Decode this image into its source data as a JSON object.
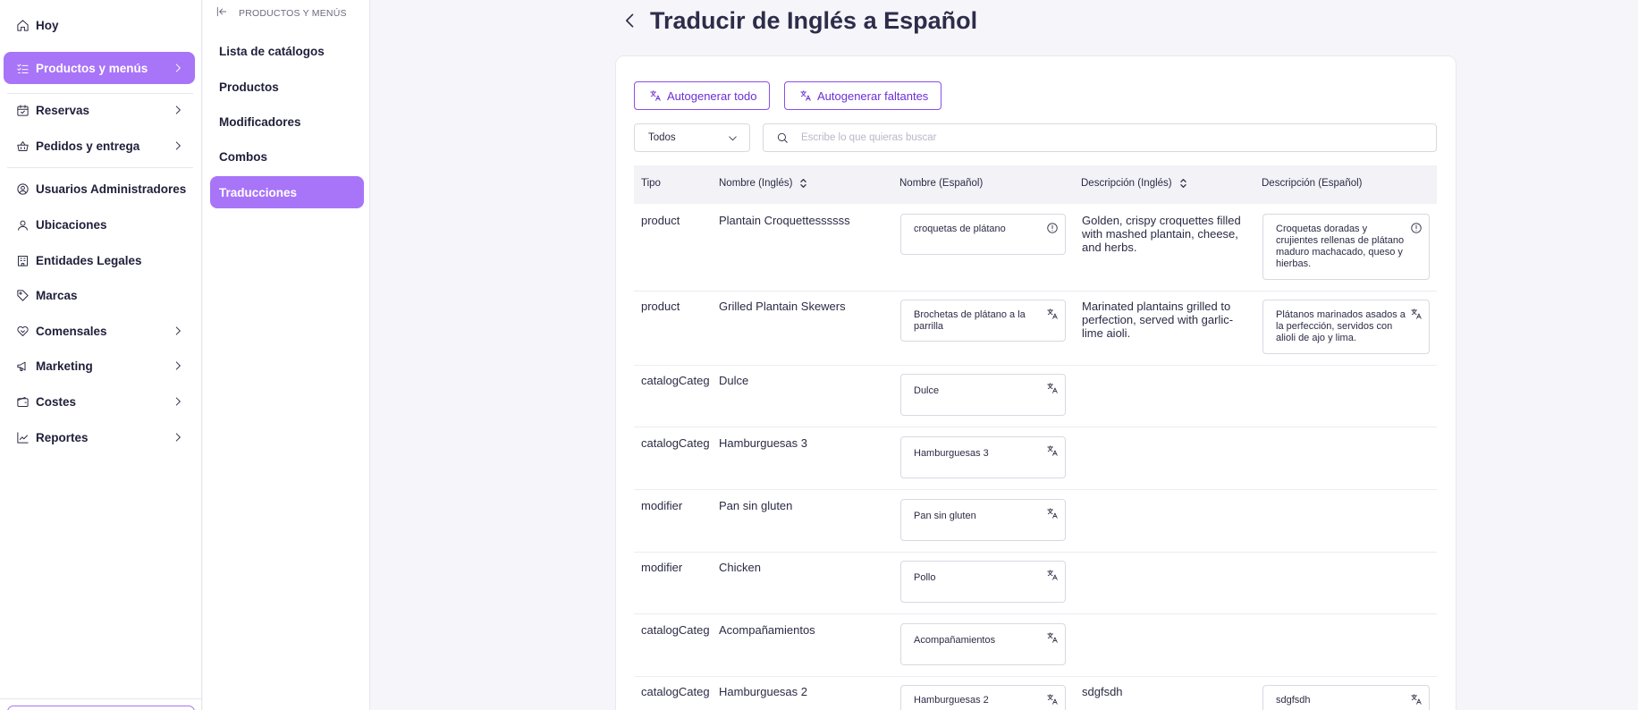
{
  "sidebar": {
    "items": [
      {
        "label": "Hoy"
      },
      {
        "label": "Productos y menús"
      },
      {
        "label": "Reservas"
      },
      {
        "label": "Pedidos y entrega"
      },
      {
        "label": "Usuarios Administradores"
      },
      {
        "label": "Ubicaciones"
      },
      {
        "label": "Entidades Legales"
      },
      {
        "label": "Marcas"
      },
      {
        "label": "Comensales"
      },
      {
        "label": "Marketing"
      },
      {
        "label": "Costes"
      },
      {
        "label": "Reportes"
      }
    ]
  },
  "subpanel": {
    "header": "PRODUCTOS Y MENÚS",
    "items": [
      {
        "label": "Lista de catálogos"
      },
      {
        "label": "Productos"
      },
      {
        "label": "Modificadores"
      },
      {
        "label": "Combos"
      },
      {
        "label": "Traducciones"
      }
    ]
  },
  "main": {
    "title": "Traducir de Inglés a Español",
    "btn_autogen_all": "Autogenerar todo",
    "btn_autogen_missing": "Autogenerar faltantes",
    "filter_value": "Todos",
    "search_placeholder": "Escribe lo que quieras buscar",
    "columns": [
      "Tipo",
      "Nombre (Inglés)",
      "Nombre (Español)",
      "Descripción (Inglés)",
      "Descripción (Español)"
    ],
    "rows": [
      {
        "type": "product",
        "name_en": "Plantain Croquettessssss",
        "name_es": "croquetas de plátano",
        "desc_en": "Golden, crispy croquettes filled with mashed plantain, cheese, and herbs.",
        "desc_es": "Croquetas doradas y crujientes rellenas de plátano maduro machacado, queso y hierbas."
      },
      {
        "type": "product",
        "name_en": "Grilled Plantain Skewers",
        "name_es": "Brochetas de plátano a la parrilla",
        "desc_en": "Marinated plantains grilled to perfection, served with garlic-lime aioli.",
        "desc_es": "Plátanos marinados asados a la perfección, servidos con alioli de ajo y lima."
      },
      {
        "type": "catalogCateg",
        "name_en": "Dulce",
        "name_es": "Dulce",
        "desc_en": "",
        "desc_es": ""
      },
      {
        "type": "catalogCateg",
        "name_en": "Hamburguesas 3",
        "name_es": "Hamburguesas 3",
        "desc_en": "",
        "desc_es": ""
      },
      {
        "type": "modifier",
        "name_en": "Pan sin gluten",
        "name_es": "Pan sin gluten",
        "desc_en": "",
        "desc_es": ""
      },
      {
        "type": "modifier",
        "name_en": "Chicken",
        "name_es": "Pollo",
        "desc_en": "",
        "desc_es": ""
      },
      {
        "type": "catalogCateg",
        "name_en": "Acompañamientos",
        "name_es": "Acompañamientos",
        "desc_en": "",
        "desc_es": ""
      },
      {
        "type": "catalogCateg",
        "name_en": "Hamburguesas 2",
        "name_es": "Hamburguesas 2",
        "desc_en": "sdgfsdh",
        "desc_es": "sdgfsdh"
      }
    ]
  },
  "colors": {
    "accent": "#a874f8",
    "button_outline": "#8a4fe8",
    "background": "#f5f5fa"
  }
}
